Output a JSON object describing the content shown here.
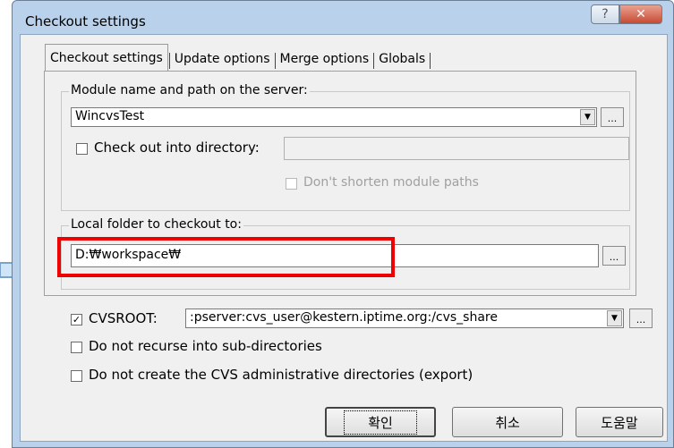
{
  "window": {
    "title": "Checkout settings",
    "help_glyph": "?",
    "close_glyph": "✕"
  },
  "tabs": [
    "Checkout settings",
    "Update options",
    "Merge options",
    "Globals"
  ],
  "module_group": {
    "label": "Module name and path on the server:",
    "module_value": "WincvsTest",
    "checkout_dir_label": "Check out into directory:",
    "checkout_dir_checked": false,
    "dont_shorten_label": "Don't shorten module paths",
    "dont_shorten_checked": false
  },
  "local_group": {
    "label": "Local folder to checkout to:",
    "folder_value": "D:₩workspace₩"
  },
  "cvsroot": {
    "label": "CVSROOT:",
    "checked": true,
    "value": ":pserver:cvs_user@kestern.iptime.org:/cvs_share"
  },
  "options": {
    "no_recurse_label": "Do not recurse into sub-directories",
    "no_admin_label": "Do not create the CVS administrative directories (export)"
  },
  "buttons": {
    "ok": "확인",
    "cancel": "취소",
    "help": "도움말",
    "ellipsis": "..."
  },
  "glyphs": {
    "dropdown": "▼",
    "check": "✓"
  },
  "colors": {
    "highlight": "#ef0000",
    "arrow_fill": "#cfe4f6",
    "arrow_stroke": "#7aa3cb"
  }
}
